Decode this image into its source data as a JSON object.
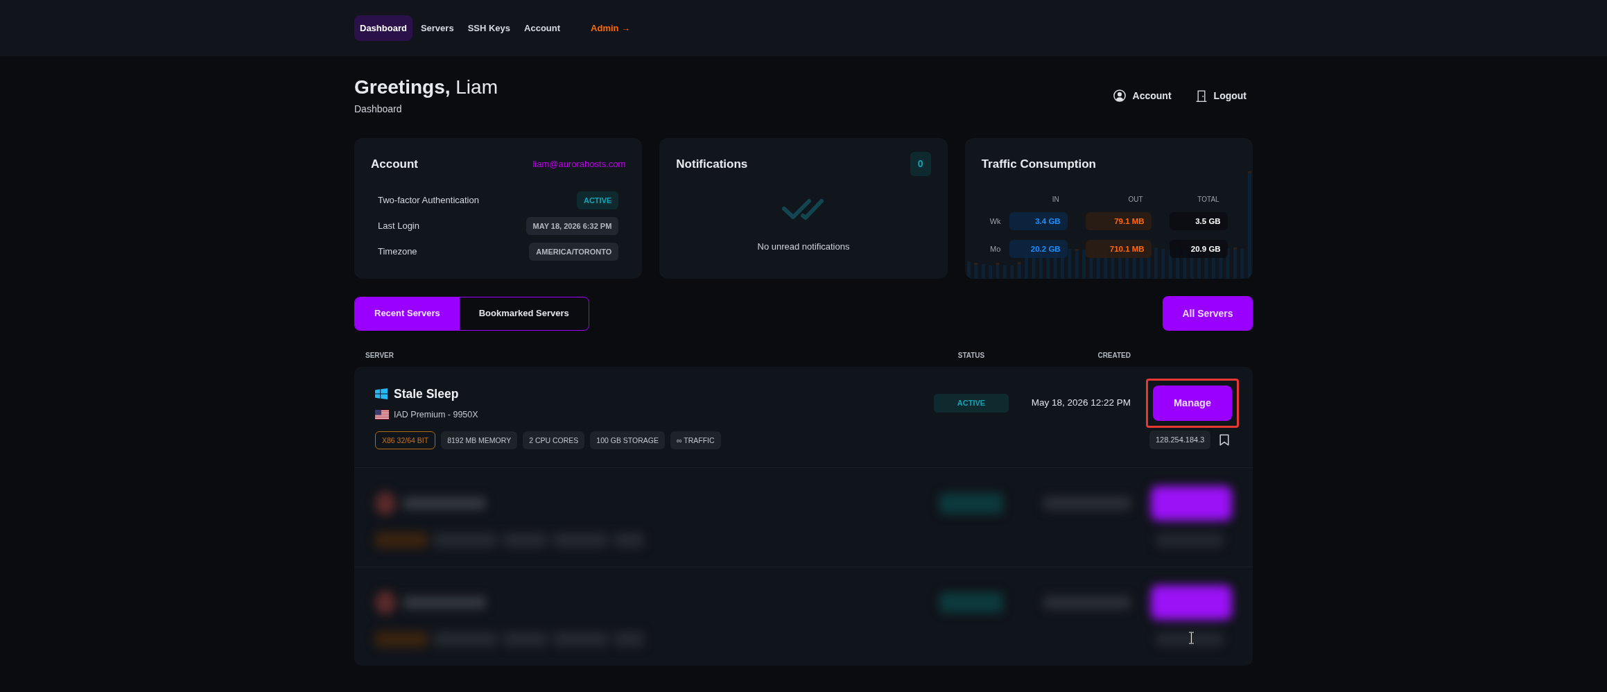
{
  "navbar": {
    "items": [
      {
        "label": "Dashboard",
        "selected": true,
        "kind": "link"
      },
      {
        "label": "Servers",
        "selected": false,
        "kind": "link"
      },
      {
        "label": "SSH Keys",
        "selected": false,
        "kind": "link"
      },
      {
        "label": "Account",
        "selected": false,
        "kind": "link"
      },
      {
        "label": "Admin →",
        "selected": false,
        "kind": "admin"
      }
    ]
  },
  "header": {
    "greeting": "**Greetings,** Liam",
    "subtitle": "Dashboard",
    "actions": [
      {
        "label": "Account",
        "kind": "account"
      },
      {
        "label": "Logout",
        "kind": "logout"
      }
    ]
  },
  "account_card": {
    "title": "Account",
    "email": "liam@aurorahosts.com",
    "rows": [
      {
        "label": "Two-factor Authentication",
        "value": "ACTIVE",
        "kind": "status"
      },
      {
        "label": "Last Login",
        "value": "MAY 18, 2026 6:32 PM",
        "kind": "plain"
      },
      {
        "label": "Timezone",
        "value": "AMERICA/TORONTO",
        "kind": "plain"
      }
    ]
  },
  "notifications_card": {
    "title": "Notifications",
    "count": "0",
    "empty_text": "No unread notifications"
  },
  "traffic_card": {
    "title": "Traffic Consumption",
    "columns": [
      "IN",
      "OUT",
      "TOTAL"
    ],
    "rows": [
      {
        "label": "Wk",
        "in": "3.4 GB",
        "out": "79.1 MB",
        "total": "3.5 GB"
      },
      {
        "label": "Mo",
        "in": "20.2 GB",
        "out": "710.1 MB",
        "total": "20.9 GB"
      }
    ]
  },
  "server_tabs": [
    {
      "label": "Recent Servers",
      "selected": true
    },
    {
      "label": "Bookmarked Servers",
      "selected": false
    }
  ],
  "all_servers_button": "All Servers",
  "table": {
    "columns": [
      "SERVER",
      "STATUS",
      "CREATED"
    ],
    "rows": [
      {
        "kind": "server",
        "name": "Stale Sleep",
        "plan": "IAD Premium - 9950X",
        "tags": [
          {
            "text": "X86 32/64 BIT",
            "kind": "outline"
          },
          {
            "text": "8192 MB MEMORY",
            "kind": "solid"
          },
          {
            "text": "2 CPU CORES",
            "kind": "solid"
          },
          {
            "text": "100 GB STORAGE",
            "kind": "solid"
          },
          {
            "text": "∞ TRAFFIC",
            "kind": "solid"
          }
        ],
        "status": "ACTIVE",
        "created": "May 18, 2026 12:22 PM",
        "action": "Manage",
        "highlighted": true,
        "ip": "128.254.184.3",
        "bookmarked": false
      },
      {
        "kind": "blurred"
      },
      {
        "kind": "blurred"
      }
    ]
  }
}
